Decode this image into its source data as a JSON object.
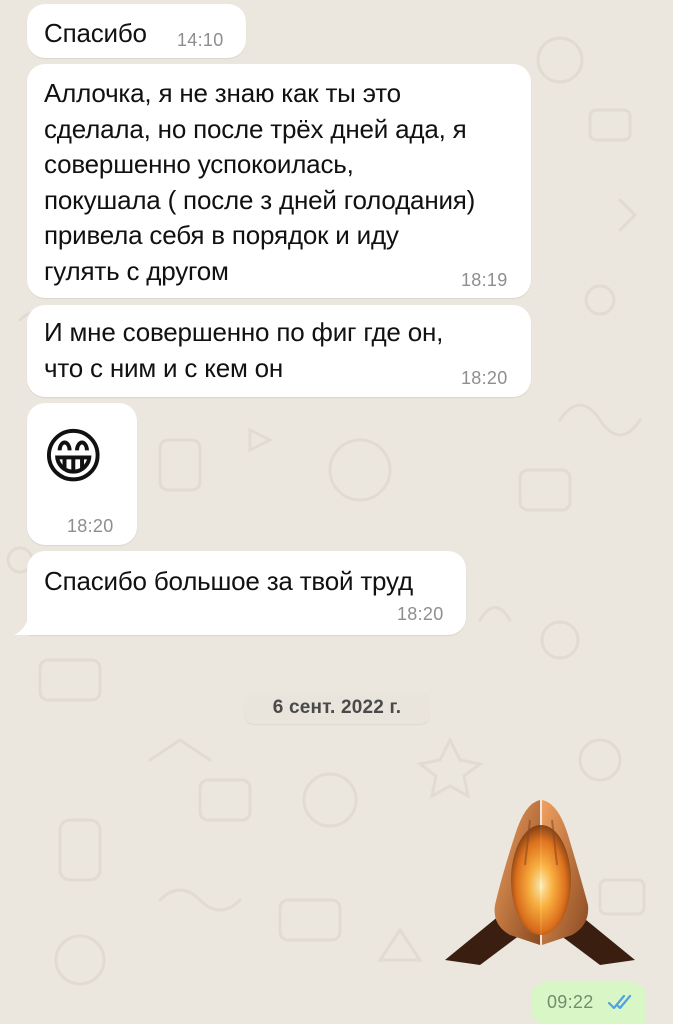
{
  "messages": [
    {
      "text": "Спасибо",
      "time": "14:10"
    },
    {
      "text": "Аллочка, я не знаю как ты это\nсделала, но после трёх дней ада, я\nсовершенно успокоилась,\nпокушала ( после з дней голодания)\nпривела себя в порядок и иду\nгулять с другом",
      "time": "18:19"
    },
    {
      "text": "И мне совершенно по фиг где он,\nчто с ним и с кем он",
      "time": "18:20"
    },
    {
      "emoji": "😁",
      "emoji_name": "grinning-face-with-smiling-eyes",
      "time": "18:20"
    },
    {
      "text": "Спасибо большое за твой труд",
      "time": "18:20"
    }
  ],
  "date_separator": "6 сент. 2022 г.",
  "outgoing": {
    "sticker": "praying-hands-sticker",
    "time": "09:22",
    "status": "read-double-check"
  },
  "colors": {
    "background": "#ebe6de",
    "incoming_bubble": "#ffffff",
    "outgoing_bubble": "#d9f6c7",
    "timestamp": "#8e8e8e",
    "read_ticks": "#4fa3e0"
  }
}
